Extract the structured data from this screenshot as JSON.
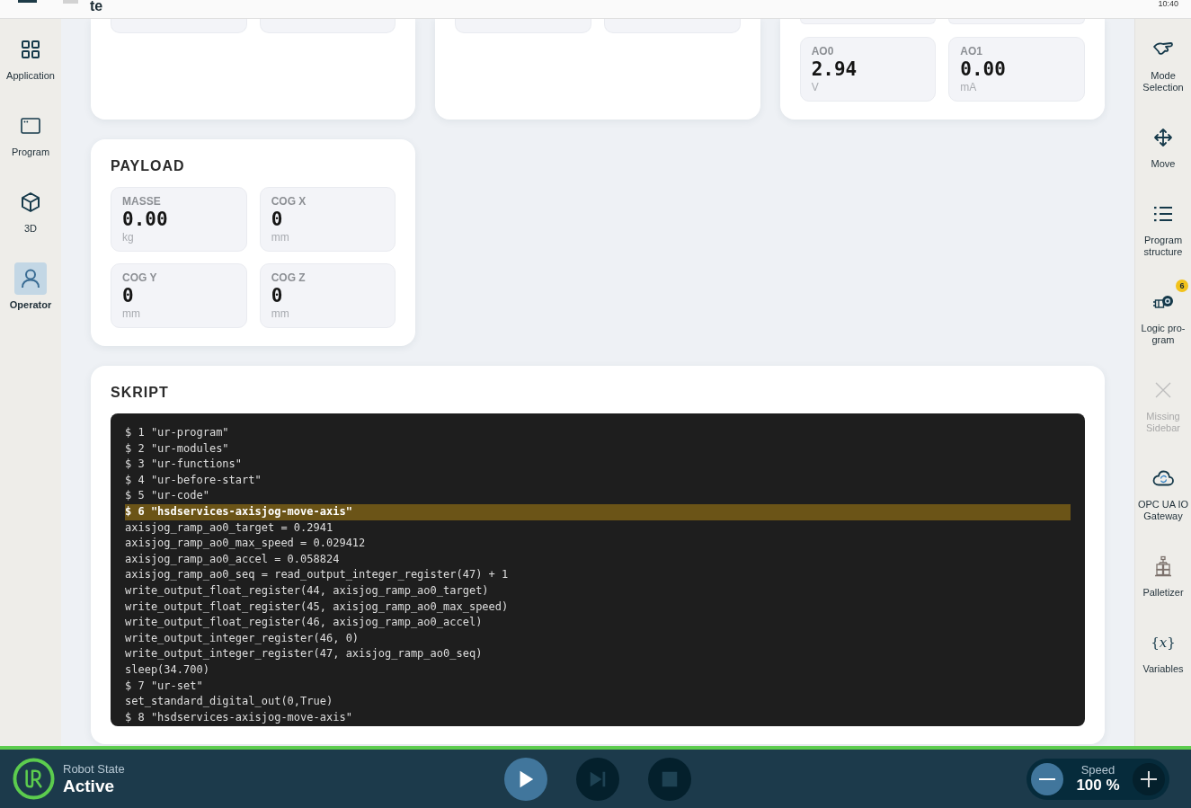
{
  "header": {
    "title": "te",
    "time": "10:40"
  },
  "nav": {
    "items": [
      {
        "label": "Application",
        "selected": false
      },
      {
        "label": "Program",
        "selected": false
      },
      {
        "label": "3D",
        "selected": false
      },
      {
        "label": "Operator",
        "selected": true
      }
    ]
  },
  "analog_outputs": {
    "fields": [
      {
        "label": "AO0",
        "value": "2.94",
        "unit": "V"
      },
      {
        "label": "AO1",
        "value": "0.00",
        "unit": "mA"
      }
    ]
  },
  "payload": {
    "title": "PAYLOAD",
    "fields": [
      {
        "label": "MASSE",
        "value": "0.00",
        "unit": "kg"
      },
      {
        "label": "COG X",
        "value": "0",
        "unit": "mm"
      },
      {
        "label": "COG Y",
        "value": "0",
        "unit": "mm"
      },
      {
        "label": "COG Z",
        "value": "0",
        "unit": "mm"
      }
    ]
  },
  "script": {
    "title": "SKRIPT",
    "lines": [
      {
        "text": "$ 1 \"ur-program\"",
        "highlighted": false
      },
      {
        "text": "$ 2 \"ur-modules\"",
        "highlighted": false
      },
      {
        "text": "$ 3 \"ur-functions\"",
        "highlighted": false
      },
      {
        "text": "$ 4 \"ur-before-start\"",
        "highlighted": false
      },
      {
        "text": "$ 5 \"ur-code\"",
        "highlighted": false
      },
      {
        "text": "$ 6 \"hsdservices-axisjog-move-axis\"",
        "highlighted": true
      },
      {
        "text": "axisjog_ramp_ao0_target = 0.2941",
        "highlighted": false
      },
      {
        "text": "axisjog_ramp_ao0_max_speed = 0.029412",
        "highlighted": false
      },
      {
        "text": "axisjog_ramp_ao0_accel = 0.058824",
        "highlighted": false
      },
      {
        "text": "axisjog_ramp_ao0_seq = read_output_integer_register(47) + 1",
        "highlighted": false
      },
      {
        "text": "write_output_float_register(44, axisjog_ramp_ao0_target)",
        "highlighted": false
      },
      {
        "text": "write_output_float_register(45, axisjog_ramp_ao0_max_speed)",
        "highlighted": false
      },
      {
        "text": "write_output_float_register(46, axisjog_ramp_ao0_accel)",
        "highlighted": false
      },
      {
        "text": "write_output_integer_register(46, 0)",
        "highlighted": false
      },
      {
        "text": "write_output_integer_register(47, axisjog_ramp_ao0_seq)",
        "highlighted": false
      },
      {
        "text": "sleep(34.700)",
        "highlighted": false
      },
      {
        "text": "$ 7 \"ur-set\"",
        "highlighted": false
      },
      {
        "text": "set_standard_digital_out(0,True)",
        "highlighted": false
      },
      {
        "text": "$ 8 \"hsdservices-axisjog-move-axis\"",
        "highlighted": false
      }
    ]
  },
  "right_sidebar": {
    "items": [
      {
        "label": "Mode Selection",
        "disabled": false
      },
      {
        "label": "Move",
        "disabled": false
      },
      {
        "label": "Program structure",
        "disabled": false
      },
      {
        "label": "Logic pro-gram",
        "disabled": false,
        "badge": "6"
      },
      {
        "label": "Missing Sidebar",
        "disabled": true
      },
      {
        "label": "OPC UA IO Gateway",
        "disabled": false
      },
      {
        "label": "Palletizer",
        "disabled": false
      },
      {
        "label": "Variables",
        "disabled": false,
        "symbol": "{*x*}"
      }
    ]
  },
  "status_bar": {
    "robot_state_label": "Robot State",
    "robot_state": "Active",
    "transport_buttons": [
      {
        "disabled": false
      },
      {
        "disabled": true
      },
      {
        "disabled": true
      }
    ],
    "speed_label": "Speed",
    "speed": "100 %",
    "speed_decrease": {
      "disabled": false
    },
    "speed_increase": {
      "disabled": true
    }
  }
}
